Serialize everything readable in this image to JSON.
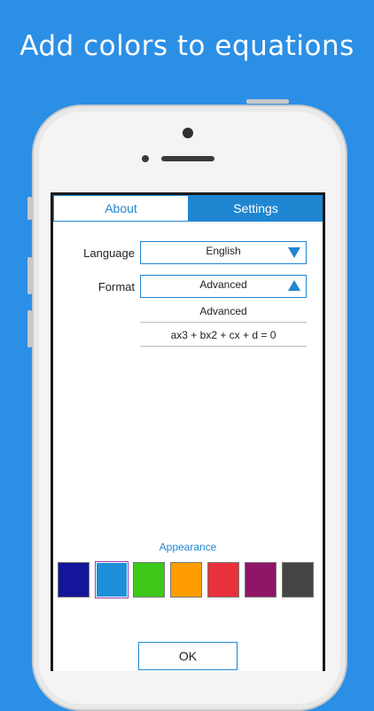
{
  "headline": "Add colors to equations",
  "tabs": [
    {
      "label": "About",
      "active": false
    },
    {
      "label": "Settings",
      "active": true
    }
  ],
  "settings": {
    "language_label": "Language",
    "language_value": "English",
    "format_label": "Format",
    "format_value": "Advanced",
    "format_options": [
      "Advanced",
      "ax3 + bx2 + cx + d = 0"
    ]
  },
  "appearance": {
    "title": "Appearance",
    "colors": [
      "#13169a",
      "#1e8fd8",
      "#3ec81a",
      "#ff9d00",
      "#e8313b",
      "#8e1567",
      "#444444"
    ],
    "selected_index": 1
  },
  "ok_label": "OK"
}
